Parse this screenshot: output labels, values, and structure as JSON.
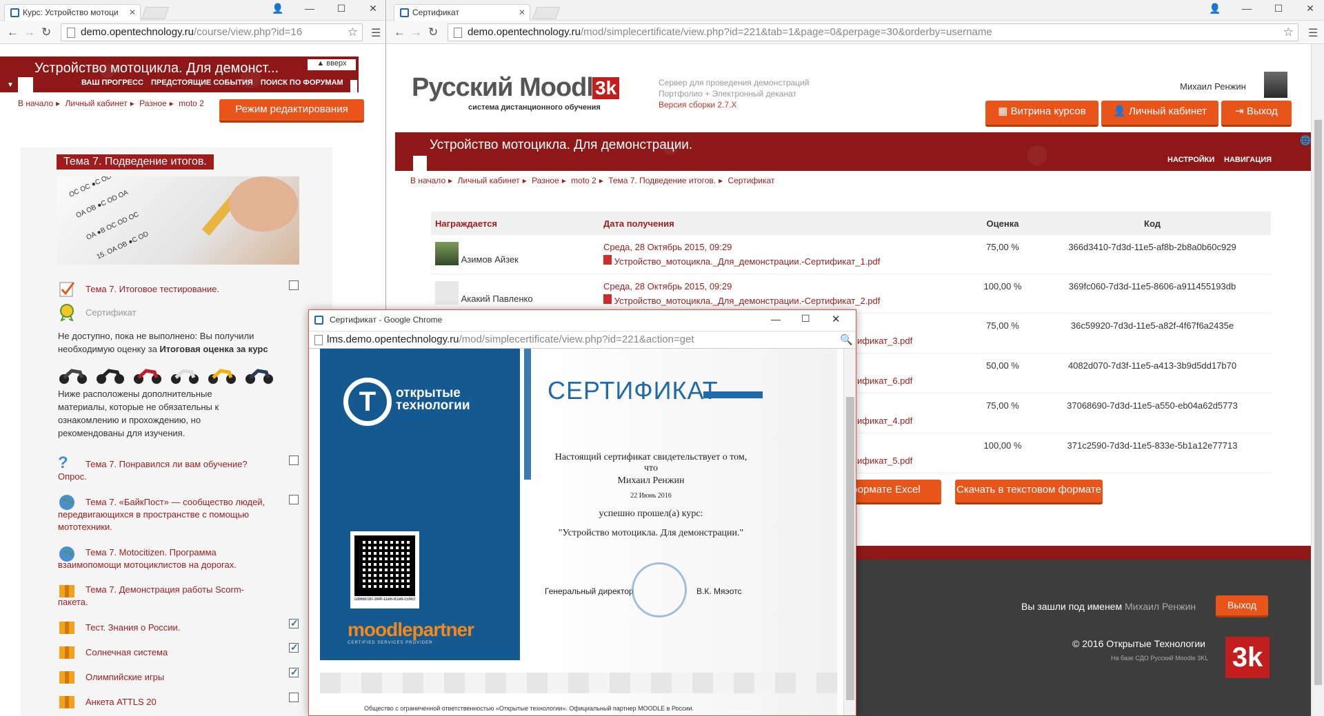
{
  "left_window": {
    "tab_title": "Курс: Устройство мотоци",
    "url_domain": "demo.opentechnology.ru",
    "url_path": "/course/view.php?id=16",
    "course_title": "Устройство мотоцикла. Для демонст...",
    "top_link": "вверх",
    "nav_links": [
      "ВАШ ПРОГРЕСС",
      "ПРЕДСТОЯЩИЕ СОБЫТИЯ",
      "ПОИСК ПО ФОРУМАМ"
    ],
    "breadcrumb": [
      "В начало",
      "Личный кабинет",
      "Разное",
      "moto 2"
    ],
    "edit_button": "Режим редактирования",
    "section_title": "Тема 7. Подведение итогов.",
    "activities": [
      {
        "label": "Тема 7. Итоговое тестирование.",
        "icon": "quiz-icon"
      },
      {
        "label": "Сертификат",
        "icon": "certificate-icon"
      }
    ],
    "restriction_text": "Не доступно, пока не выполнено: Вы получили необходимую оценку за",
    "restriction_bold": "Итоговая оценка за курс",
    "extra_text": "Ниже расположены дополнительные материалы, которые не обязательны к ознакомлению и прохождению, но рекомендованы для изучения.",
    "extra_activities": [
      {
        "label": "Тема 7. Понравился ли вам обучение?",
        "sub": "Опрос.",
        "icon": "question-icon",
        "checked": false
      },
      {
        "label": "Тема 7. «БайкПост» — сообщество людей, передвигающихся в пространстве с помощью мототехники.",
        "icon": "globe-icon",
        "checked": false
      },
      {
        "label": "Тема 7. Motocitizen. Программа взаимопомощи мотоциклистов на дорогах.",
        "icon": "globe-icon",
        "checked": false
      },
      {
        "label": "Тема 7. Демонстрация работы Scorm-пакета.",
        "icon": "package-icon",
        "checked": false
      },
      {
        "label": "Тест. Знания о России.",
        "icon": "package-icon",
        "checked": true
      },
      {
        "label": "Солнечная система",
        "icon": "package-icon",
        "checked": true
      },
      {
        "label": "Олимпийские игры",
        "icon": "package-icon",
        "checked": true
      },
      {
        "label": "Анкета ATTLS 20",
        "icon": "package-icon",
        "checked": false
      }
    ]
  },
  "right_window": {
    "tab_title": "Сертификат",
    "url_domain": "demo.opentechnology.ru",
    "url_path": "/mod/simplecertificate/view.php?id=221&tab=1&page=0&perpage=30&orderby=username",
    "logo_text": "Русский Moodle",
    "logo_badge": "3k",
    "logo_sub": "система дистанционного обучения",
    "server_info": [
      "Сервер для проведения демонстраций",
      "Портфолио + Электронный деканат",
      "Версия сборки 2.7.X"
    ],
    "user_name": "Михаил Ренжин",
    "header_buttons": [
      "Витрина курсов",
      "Личный кабинет",
      "Выход"
    ],
    "course_title": "Устройство мотоцикла. Для демонстрации.",
    "banner_links": [
      "НАСТРОЙКИ",
      "НАВИГАЦИЯ"
    ],
    "breadcrumb": [
      "В начало",
      "Личный кабинет",
      "Разное",
      "moto 2",
      "Тема 7. Подведение итогов.",
      "Сертификат"
    ],
    "table": {
      "headers": [
        "Награждается",
        "Дата получения",
        "Оценка",
        "Код"
      ],
      "rows": [
        {
          "name": "Азимов Айзек",
          "date": "Среда, 28 Октябрь 2015, 09:29",
          "file": "Устройство_мотоцикла._Для_демонстрации.-Сертификат_1.pdf",
          "grade": "75,00 %",
          "code": "366d3410-7d3d-11e5-af8b-2b8a0b60c929"
        },
        {
          "name": "Акакий Павленко",
          "date": "Среда, 28 Октябрь 2015, 09:29",
          "file": "Устройство_мотоцикла._Для_демонстрации.-Сертификат_2.pdf",
          "grade": "100,00 %",
          "code": "369fc060-7d3d-11e5-8606-a911455193db"
        },
        {
          "name": "",
          "date": "",
          "file": "ификат_3.pdf",
          "grade": "75,00 %",
          "code": "36c59920-7d3d-11e5-a82f-4f67f6a2435e"
        },
        {
          "name": "",
          "date": "",
          "file": "ификат_6.pdf",
          "grade": "50,00 %",
          "code": "4082d070-7d3f-11e5-a413-3b9d5dd17b70"
        },
        {
          "name": "",
          "date": "",
          "file": "ификат_4.pdf",
          "grade": "75,00 %",
          "code": "37068690-7d3d-11e5-a550-eb04a62d5773"
        },
        {
          "name": "",
          "date": "",
          "file": "ификат_5.pdf",
          "grade": "100,00 %",
          "code": "371c2590-7d3d-11e5-833e-5b1a12e77713"
        }
      ]
    },
    "download_excel": "формате Excel",
    "download_text": "Скачать в текстовом формате",
    "logged_in_as": "Вы зашли под именем",
    "logged_user": "Михаил Ренжин",
    "logout": "Выход",
    "copyright": "© 2016 Открытые Технологии",
    "powered": "На базе СДО Русский Moodle 3KL"
  },
  "popup": {
    "title": "Сертификат - Google Chrome",
    "url_domain": "lms.demo.opentechnology.ru",
    "url_path": "/mod/simplecertificate/view.php?id=221&action=get",
    "org_name_1": "открытые",
    "org_name_2": "технологии",
    "cert_heading": "СЕРТИФИКАТ",
    "line1": "Настоящий сертификат свидетельствует о том, что",
    "recipient": "Михаил Ренжин",
    "date": "22 Июнь 2016",
    "line2": "успешно прошел(а) курс:",
    "course": "\"Устройство мотоцикла. Для демонстрации.\"",
    "qr_code": "cd868030-384f-11e6-81eb-c5f4c9b3e172",
    "partner_logo": "moodlepartner",
    "partner_sub": "CERTIFIED SERVICES PROVIDER",
    "director_label": "Генеральный директор",
    "director_name": "В.К. Мяэотс",
    "footer": "Общество с ограниченной ответственностью «Открытые технологии». Официальный партнер MOODLE в России."
  }
}
